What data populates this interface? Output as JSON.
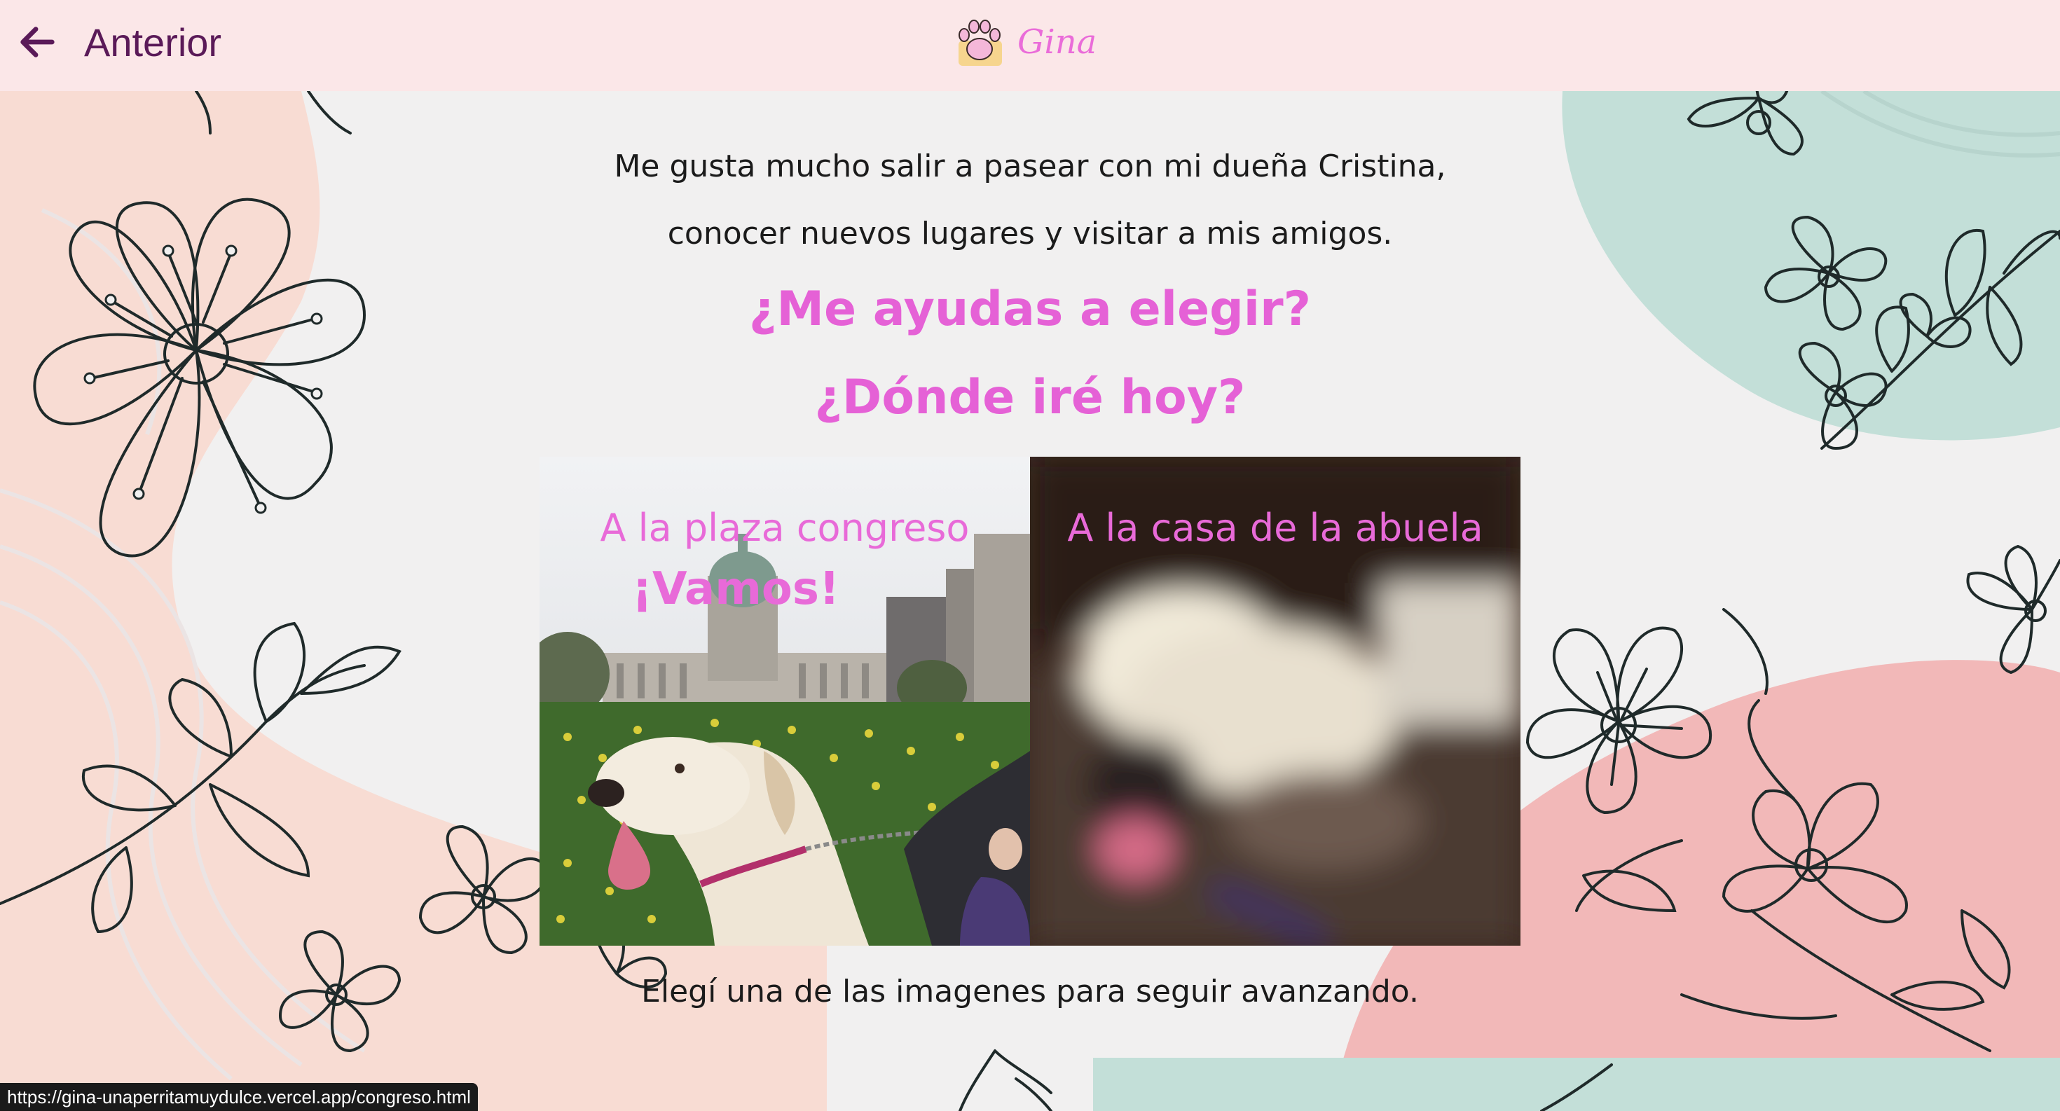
{
  "header": {
    "back_label": "Anterior",
    "logo_text": "Gina"
  },
  "intro": {
    "line1": "Me gusta mucho salir a pasear con mi dueña Cristina,",
    "line2": "conocer nuevos lugares y visitar a mis amigos."
  },
  "question": {
    "line1": "¿Me ayudas a elegir?",
    "line2": "¿Dónde iré hoy?"
  },
  "options": [
    {
      "label": "A la plaza congreso",
      "cta": "¡Vamos!",
      "state": "hovered"
    },
    {
      "label": "A la casa de la abuela",
      "state": "blurred"
    }
  ],
  "hint": "Elegí una de las imagenes para seguir avanzando.",
  "status_url": "https://gina-unaperritamuydulce.vercel.app/congreso.html",
  "colors": {
    "accent": "#e561d6",
    "topbar": "#fbe7e8",
    "back_text": "#5a1a58"
  }
}
